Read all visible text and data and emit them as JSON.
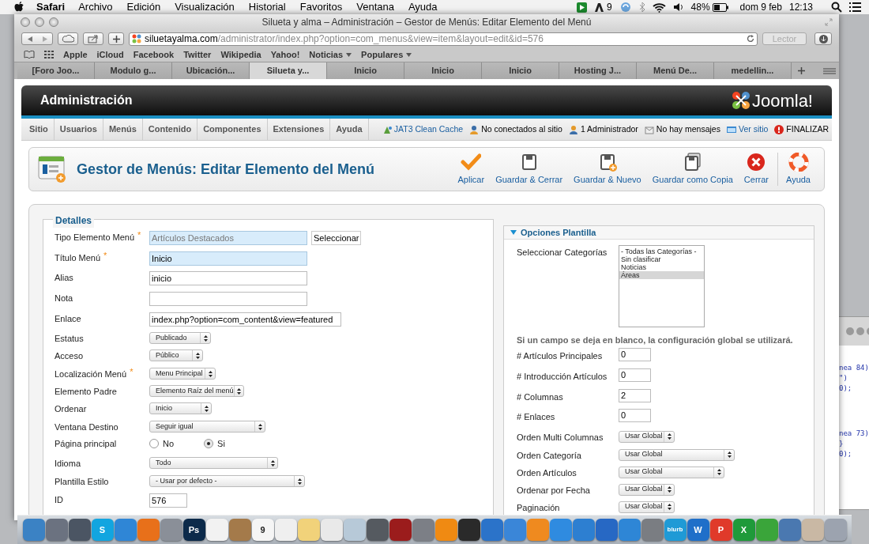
{
  "menu_bar": {
    "app": "Safari",
    "items": [
      "Archivo",
      "Edición",
      "Visualización",
      "Historial",
      "Favoritos",
      "Ventana",
      "Ayuda"
    ],
    "badge": "9",
    "battery": "48%",
    "date": "dom 9 feb",
    "time": "12:13"
  },
  "browser": {
    "title": "Silueta y alma – Administración – Gestor de Menús: Editar Elemento del Menú",
    "url_domain": "siluetayalma.com",
    "url_path": "/administrator/index.php?option=com_menus&view=item&layout=edit&id=576",
    "reader": "Lector",
    "bookmarks": [
      {
        "label": "Apple",
        "menu": false
      },
      {
        "label": "iCloud",
        "menu": false
      },
      {
        "label": "Facebook",
        "menu": false
      },
      {
        "label": "Twitter",
        "menu": false
      },
      {
        "label": "Wikipedia",
        "menu": false
      },
      {
        "label": "Yahoo!",
        "menu": false
      },
      {
        "label": "Noticias",
        "menu": true
      },
      {
        "label": "Populares",
        "menu": true
      }
    ],
    "tabs": [
      {
        "label": "[Foro Joo...",
        "selected": false
      },
      {
        "label": "Modulo g...",
        "selected": false
      },
      {
        "label": "Ubicación...",
        "selected": false
      },
      {
        "label": "Silueta y...",
        "selected": true
      },
      {
        "label": "Inicio",
        "selected": false
      },
      {
        "label": "Inicio",
        "selected": false
      },
      {
        "label": "Inicio",
        "selected": false
      },
      {
        "label": "Hosting J...",
        "selected": false
      },
      {
        "label": "Menú De...",
        "selected": false
      },
      {
        "label": "medellin...",
        "selected": false
      }
    ]
  },
  "admin": {
    "brand": "Administración",
    "logo": "Joomla!",
    "nav": [
      "Sitio",
      "Usuarios",
      "Menús",
      "Contenido",
      "Componentes",
      "Extensiones",
      "Ayuda"
    ],
    "status": [
      {
        "kind": "cache",
        "label": "JAT3 Clean Cache",
        "link": true
      },
      {
        "kind": "visitors",
        "label": "No conectados al sitio",
        "link": false
      },
      {
        "kind": "admins",
        "label": "1 Administrador",
        "link": false
      },
      {
        "kind": "messages",
        "label": "No hay mensajes",
        "link": false
      },
      {
        "kind": "site",
        "label": "Ver sitio",
        "link": true
      },
      {
        "kind": "logout",
        "label": "FINALIZAR",
        "link": false
      }
    ],
    "page_title": "Gestor de Menús: Editar Elemento del Menú",
    "toolbar": [
      {
        "kind": "apply",
        "label": "Aplicar"
      },
      {
        "kind": "save",
        "label": "Guardar & Cerrar"
      },
      {
        "kind": "save-new",
        "label": "Guardar & Nuevo"
      },
      {
        "kind": "save-copy",
        "label": "Guardar como Copia"
      },
      {
        "kind": "cancel",
        "label": "Cerrar"
      },
      {
        "kind": "help",
        "label": "Ayuda"
      }
    ]
  },
  "details": {
    "legend": "Detalles",
    "fields": [
      {
        "label": "Tipo Elemento Menú",
        "required_mark": "*",
        "kind": "text",
        "value": "Artículos Destacados",
        "highlighted": true,
        "disabled": true,
        "button": "Seleccionar"
      },
      {
        "label": "Título Menú",
        "required_mark": "*",
        "kind": "text",
        "value": "Inicio",
        "highlighted": true,
        "disabled": false
      },
      {
        "label": "Alias",
        "kind": "text",
        "value": "inicio",
        "highlighted": false,
        "disabled": false
      },
      {
        "label": "Nota",
        "kind": "text",
        "highlighted": false
      },
      {
        "label": "Enlace",
        "kind": "text",
        "value": "index.php?option=com_content&view=featured",
        "highlighted": false,
        "disabled": false
      },
      {
        "label": "Estatus",
        "kind": "select",
        "value": "Publicado"
      },
      {
        "label": "Acceso",
        "kind": "select",
        "value": "Público"
      },
      {
        "label": "Localización Menú",
        "required_mark": "*",
        "kind": "select",
        "value": "Menu Principal"
      },
      {
        "label": "Elemento Padre",
        "kind": "select",
        "value": "Elemento Raíz del menú"
      },
      {
        "label": "Ordenar",
        "kind": "select",
        "value": "Inicio"
      },
      {
        "label": "Ventana Destino",
        "kind": "select",
        "value": "Seguir igual"
      },
      {
        "label": "Página principal",
        "kind": "radio",
        "options": [
          {
            "label": "No",
            "selected": false
          },
          {
            "label": "Si",
            "selected": true
          }
        ]
      },
      {
        "label": "Idioma",
        "kind": "select",
        "value": "Todo"
      },
      {
        "label": "Plantilla Estilo",
        "kind": "select",
        "value": "- Usar por defecto -"
      },
      {
        "label": "ID",
        "kind": "text",
        "value": "576",
        "highlighted": false,
        "disabled": false
      }
    ]
  },
  "options": {
    "title": "Opciones Plantilla",
    "expanded": true,
    "categories_label": "Seleccionar Categorías",
    "categories": [
      {
        "label": "- Todas las Categorías -",
        "selected": false
      },
      {
        "label": "Sin clasificar",
        "selected": false
      },
      {
        "label": "Noticias",
        "selected": false
      },
      {
        "label": "Áreas",
        "selected": true
      }
    ],
    "note": "Si un campo se deja en blanco, la configuración global se utilizará.",
    "fields": [
      {
        "label": "# Artículos Principales",
        "kind": "text",
        "value": "0"
      },
      {
        "label": "# Introducción Artículos",
        "kind": "text",
        "value": "0"
      },
      {
        "label": "# Columnas",
        "kind": "text",
        "value": "2"
      },
      {
        "label": "# Enlaces",
        "kind": "text",
        "value": "0"
      },
      {
        "label": "Orden Multi Columnas",
        "kind": "select",
        "value": "Usar Global"
      },
      {
        "label": "Orden Categoría",
        "kind": "select",
        "value": "Usar Global"
      },
      {
        "label": "Orden Artículos",
        "kind": "select",
        "value": "Usar Global"
      },
      {
        "label": "Ordenar por Fecha",
        "kind": "select",
        "value": "Usar Global"
      },
      {
        "label": "Paginación",
        "kind": "select",
        "value": "Usar Global"
      }
    ]
  },
  "background_code": [
    "nea 84)",
    "\")",
    "0);",
    "nea 73)",
    "}",
    "0);"
  ],
  "dock": [
    {
      "color": "#3b82c4"
    },
    {
      "color": "#6b7280"
    },
    {
      "color": "#4b5563"
    },
    {
      "color": "#12a5e0",
      "label": "S"
    },
    {
      "color": "#2f86d6"
    },
    {
      "color": "#e8701a"
    },
    {
      "color": "#8a8f98"
    },
    {
      "color": "#0c2a4a",
      "label": "Ps"
    },
    {
      "color": "#f2f2f2"
    },
    {
      "color": "#a47a4a"
    },
    {
      "color": "#f5f5f5",
      "label": "9"
    },
    {
      "color": "#efefef"
    },
    {
      "color": "#f1d27a"
    },
    {
      "color": "#e9e9e9"
    },
    {
      "color": "#b7c9d8"
    },
    {
      "color": "#555a60"
    },
    {
      "color": "#9b1c1c"
    },
    {
      "color": "#7c7f86"
    },
    {
      "color": "#f08a12"
    },
    {
      "color": "#2a2a2a"
    },
    {
      "color": "#2b73c9"
    },
    {
      "color": "#3a86d8"
    },
    {
      "color": "#ef8a1f"
    },
    {
      "color": "#2f8be0"
    },
    {
      "color": "#2d7fd1"
    },
    {
      "color": "#2768c4"
    },
    {
      "color": "#2e86d6"
    },
    {
      "color": "#7a7d82"
    },
    {
      "color": "#1f9ad6",
      "label": "blurb"
    },
    {
      "color": "#1f6fc9",
      "label": "W"
    },
    {
      "color": "#e03a2a",
      "label": "P"
    },
    {
      "color": "#1f9a3a",
      "label": "X"
    },
    {
      "color": "#3aa53a"
    },
    {
      "color": "#4a78b0"
    },
    {
      "color": "#c9b8a4"
    },
    {
      "color": "#9ca3af"
    }
  ]
}
